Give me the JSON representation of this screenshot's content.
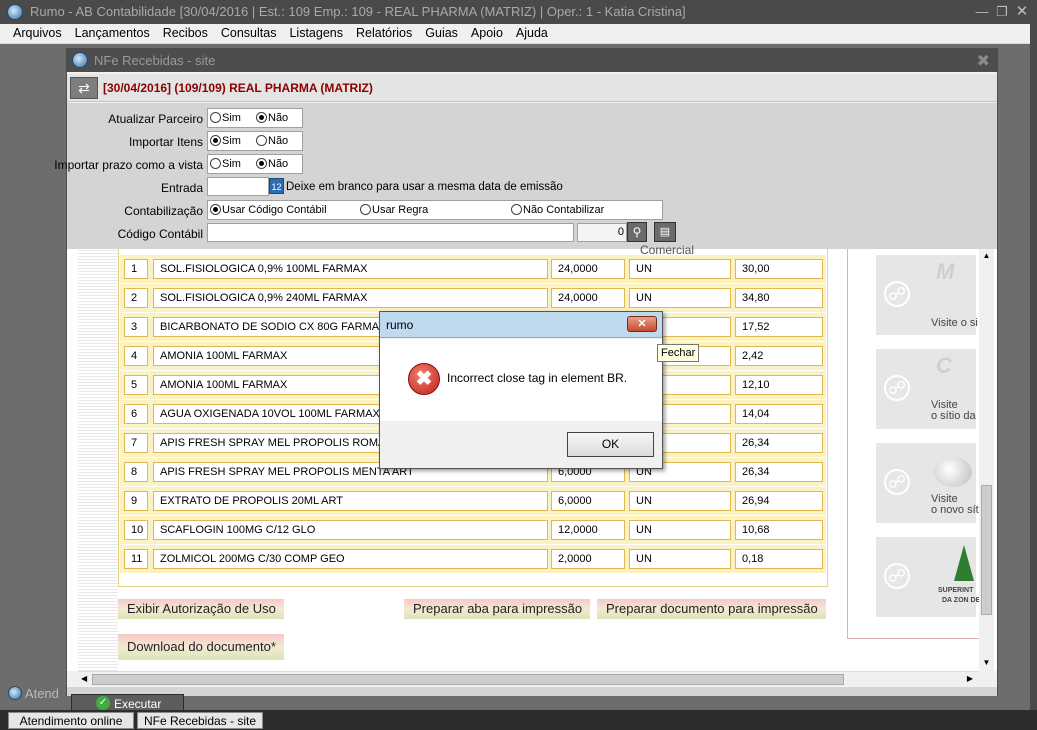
{
  "window": {
    "title": "Rumo - AB Contabilidade [30/04/2016 | Est.: 109 Emp.: 109 - REAL PHARMA (MATRIZ) | Oper.: 1 - Katia Cristina]"
  },
  "menu": [
    "Arquivos",
    "Lançamentos",
    "Recibos",
    "Consultas",
    "Listagens",
    "Relatórios",
    "Guias",
    "Apoio",
    "Ajuda"
  ],
  "child": {
    "title": "NFe Recebidas - site",
    "header": "[30/04/2016] (109/109) REAL PHARMA (MATRIZ)"
  },
  "form": {
    "atualizar_parceiro": {
      "label": "Atualizar Parceiro",
      "sim": "Sim",
      "nao": "Não",
      "selected": "nao"
    },
    "importar_itens": {
      "label": "Importar Itens",
      "sim": "Sim",
      "nao": "Não",
      "selected": "sim"
    },
    "importar_prazo": {
      "label": "Importar prazo como a vista",
      "sim": "Sim",
      "nao": "Não",
      "selected": "nao"
    },
    "entrada": {
      "label": "Entrada",
      "value": "",
      "hint": "Deixe em branco para usar a mesma data de emissão"
    },
    "contabilizacao": {
      "label": "Contabilização",
      "opt1": "Usar Código Contábil",
      "opt2": "Usar Regra",
      "opt3": "Não Contabilizar",
      "selected": "opt1"
    },
    "codigo_contabil": {
      "label": "Código Contábil",
      "value": "",
      "number": "0"
    }
  },
  "table": {
    "header_fragment": "Comercial",
    "rows": [
      {
        "n": "1",
        "desc": "SOL.FISIOLOGICA 0,9% 100ML FARMAX",
        "qty": "24,0000",
        "unit": "UN",
        "value": "30,00"
      },
      {
        "n": "2",
        "desc": "SOL.FISIOLOGICA 0,9% 240ML FARMAX",
        "qty": "24,0000",
        "unit": "UN",
        "value": "34,80"
      },
      {
        "n": "3",
        "desc": "BICARBONATO DE SODIO CX 80G FARMAX",
        "qty": "",
        "unit": "",
        "value": "17,52"
      },
      {
        "n": "4",
        "desc": "AMONIA 100ML FARMAX",
        "qty": "",
        "unit": "",
        "value": "2,42"
      },
      {
        "n": "5",
        "desc": "AMONIA 100ML FARMAX",
        "qty": "",
        "unit": "",
        "value": "12,10"
      },
      {
        "n": "6",
        "desc": "AGUA OXIGENADA 10VOL 100ML FARMAX",
        "qty": "",
        "unit": "",
        "value": "14,04"
      },
      {
        "n": "7",
        "desc": "APIS FRESH SPRAY MEL PROPOLIS ROMA A",
        "qty": "",
        "unit": "",
        "value": "26,34"
      },
      {
        "n": "8",
        "desc": "APIS FRESH SPRAY MEL PROPOLIS MENTA ART",
        "qty": "6,0000",
        "unit": "UN",
        "value": "26,34"
      },
      {
        "n": "9",
        "desc": "EXTRATO DE PROPOLIS 20ML ART",
        "qty": "6,0000",
        "unit": "UN",
        "value": "26,94"
      },
      {
        "n": "10",
        "desc": "SCAFLOGIN 100MG C/12 GLO",
        "qty": "12,0000",
        "unit": "UN",
        "value": "10,68"
      },
      {
        "n": "11",
        "desc": "ZOLMICOL 200MG C/30 COMP GEO",
        "qty": "2,0000",
        "unit": "UN",
        "value": "0,18"
      }
    ]
  },
  "actions": {
    "exibir": "Exibir Autorização de Uso",
    "preparar_aba": "Preparar aba para impressão",
    "preparar_doc": "Preparar documento para impressão",
    "download": "Download do documento*"
  },
  "sidebar": {
    "cards": [
      {
        "logo": "M",
        "line1": "Visite o si",
        "line2": ""
      },
      {
        "logo": "C",
        "line1": "Visite",
        "line2": "o sítio da"
      },
      {
        "logo": "",
        "line1": "Visite",
        "line2": "o novo sít"
      },
      {
        "logo": "",
        "line1": "SUPERINT",
        "line2": "DA ZON DE M"
      }
    ]
  },
  "footer": {
    "executar": "Executar",
    "atend_bg": "Atend"
  },
  "taskbar": [
    "Atendimento online",
    "NFe Recebidas - site"
  ],
  "dialog": {
    "title": "rumo",
    "message": "Incorrect close tag in element BR.",
    "ok": "OK",
    "tooltip": "Fechar"
  }
}
